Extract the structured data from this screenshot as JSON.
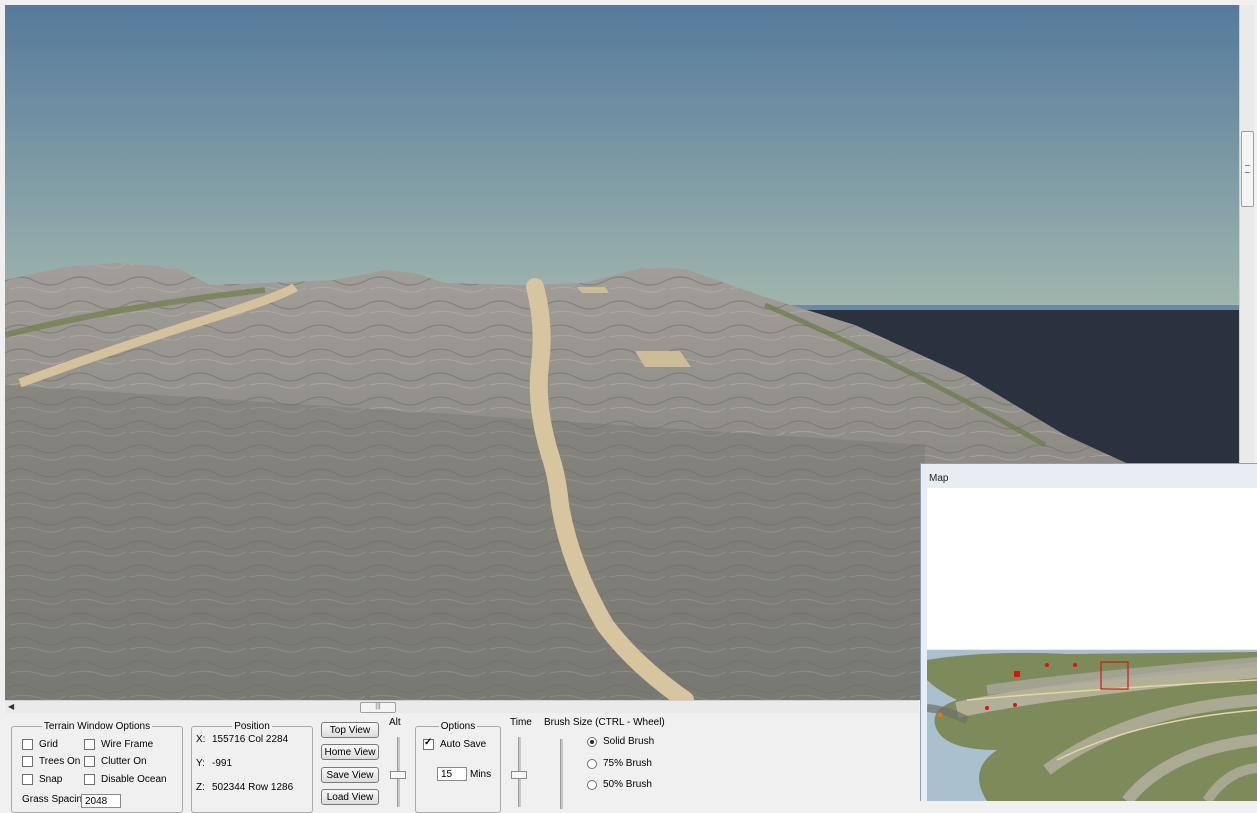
{
  "terrain_options": {
    "legend": "Terrain Window Options",
    "grid": "Grid",
    "wire_frame": "Wire Frame",
    "trees_on": "Trees On",
    "clutter_on": "Clutter On",
    "snap": "Snap",
    "disable_ocean": "Disable Ocean",
    "grass_spacing_label": "Grass Spacing",
    "grass_spacing_value": "2048"
  },
  "position": {
    "legend": "Position",
    "x_label": "X:",
    "x_value": "155716 Col 2284",
    "y_label": "Y:",
    "y_value": "-991",
    "z_label": "Z:",
    "z_value": "502344  Row 1286"
  },
  "view_buttons": {
    "top": "Top View",
    "home": "Home View",
    "save": "Save View",
    "load": "Load View"
  },
  "alt_label": "Alt",
  "options": {
    "legend": "Options",
    "auto_save": "Auto Save",
    "auto_save_checked": true,
    "mins_value": "15",
    "mins_label": "Mins"
  },
  "time_label": "Time",
  "brush": {
    "title": "Brush Size (CTRL - Wheel)",
    "solid": "Solid Brush",
    "p75": "75% Brush",
    "p50": "50% Brush",
    "selected": "solid"
  },
  "map_window": {
    "title": "Map"
  },
  "colors": {
    "sky_top": "#557a9c",
    "sky_bottom": "#9bb3ad",
    "ocean": "#2a323d",
    "terrain": "#8a8a84",
    "road": "#d3c29c",
    "map_marker": "#e01010"
  }
}
